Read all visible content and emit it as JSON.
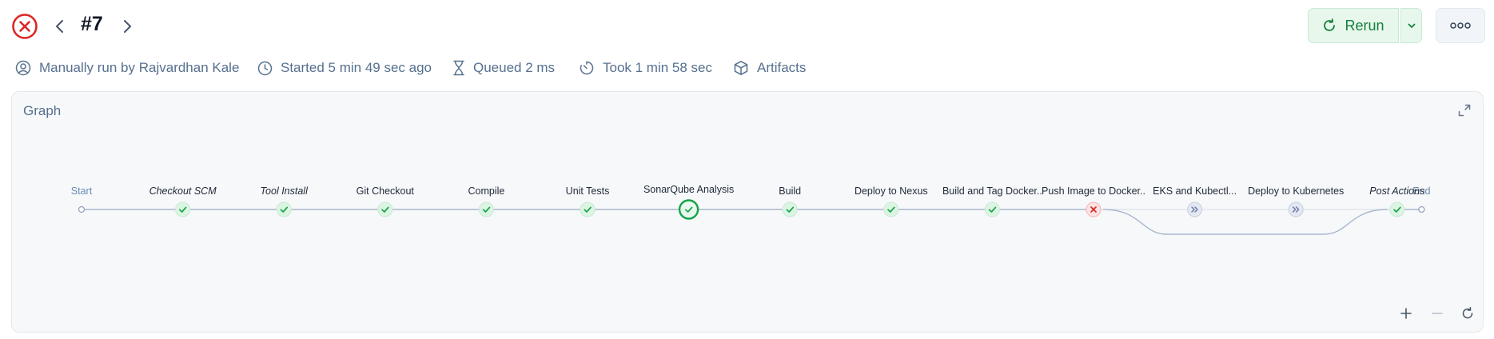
{
  "run": {
    "title": "#7",
    "status": "failed"
  },
  "header": {
    "rerun_label": "Rerun"
  },
  "meta": {
    "trigger": "Manually run by Rajvardhan Kale",
    "started": "Started 5 min 49 sec ago",
    "queued": "Queued 2 ms",
    "duration": "Took 1 min 58 sec",
    "artifacts": "Artifacts"
  },
  "graph": {
    "title": "Graph",
    "start_label": "Start",
    "end_label": "End",
    "stages": [
      {
        "label": "Checkout SCM",
        "status": "success",
        "italic": true
      },
      {
        "label": "Tool Install",
        "status": "success",
        "italic": true
      },
      {
        "label": "Git Checkout",
        "status": "success",
        "italic": false
      },
      {
        "label": "Compile",
        "status": "success",
        "italic": false
      },
      {
        "label": "Unit Tests",
        "status": "success",
        "italic": false
      },
      {
        "label": "SonarQube Analysis",
        "status": "success",
        "italic": false,
        "selected": true
      },
      {
        "label": "Build",
        "status": "success",
        "italic": false
      },
      {
        "label": "Deploy to Nexus",
        "status": "success",
        "italic": false
      },
      {
        "label": "Build and Tag Docker..",
        "status": "success",
        "italic": false
      },
      {
        "label": "Push Image to Docker..",
        "status": "failed",
        "italic": false
      },
      {
        "label": "EKS and Kubectl...",
        "status": "skipped",
        "italic": false
      },
      {
        "label": "Deploy to Kubernetes",
        "status": "skipped",
        "italic": false
      },
      {
        "label": "Post Actions",
        "status": "success",
        "italic": true
      }
    ]
  },
  "colors": {
    "success": "#16a34a",
    "success_fill": "#dcf5e3",
    "failed": "#dc2626",
    "failed_fill": "#fde2e2",
    "skipped": "#6b7fa8",
    "skipped_fill": "#e3e8f2",
    "edge": "#a8b8cc",
    "muted": "#56708f"
  }
}
